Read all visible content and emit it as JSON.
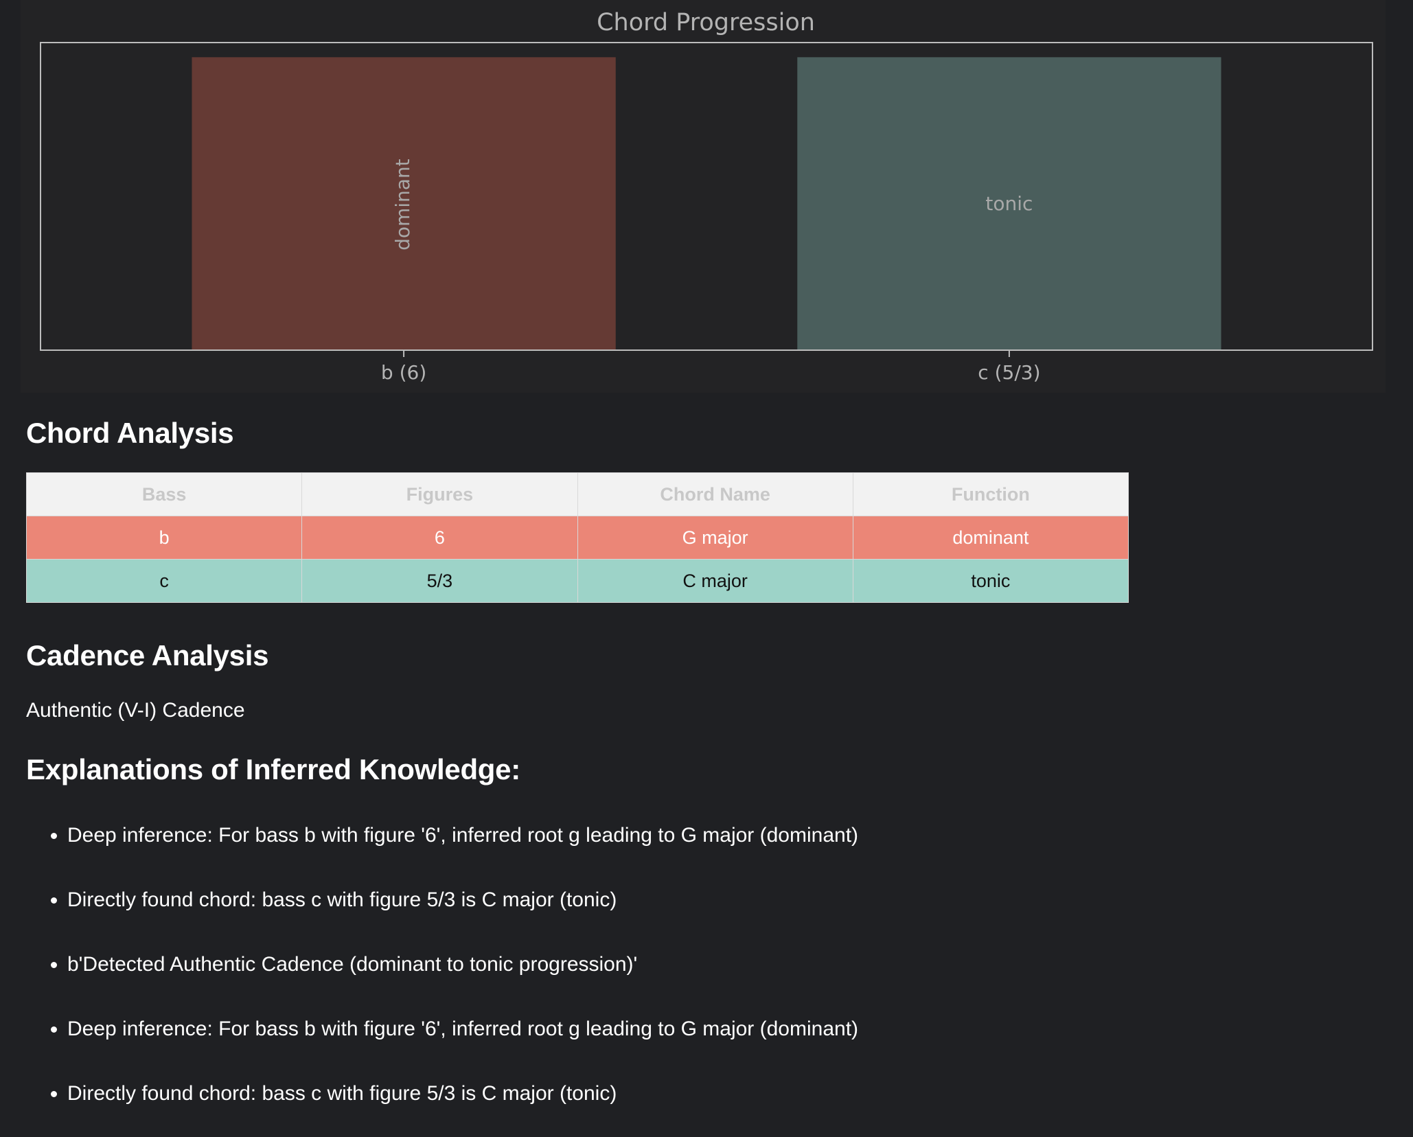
{
  "chart_data": {
    "type": "bar",
    "title": "Chord Progression",
    "categories": [
      "b (6)",
      "c (5/3)"
    ],
    "values": [
      1,
      1
    ],
    "bar_labels": [
      "dominant",
      "tonic"
    ],
    "bar_colors": [
      "#653a34",
      "#4a5e5c"
    ],
    "ylim": [
      0,
      1.05
    ],
    "xlabel": "",
    "ylabel": "",
    "grid": false
  },
  "chord_analysis": {
    "heading": "Chord Analysis",
    "columns": [
      "Bass",
      "Figures",
      "Chord Name",
      "Function"
    ],
    "rows": [
      {
        "bass": "b",
        "figures": "6",
        "chord_name": "G major",
        "function": "dominant"
      },
      {
        "bass": "c",
        "figures": "5/3",
        "chord_name": "C major",
        "function": "tonic"
      }
    ],
    "colors": {
      "dominant": "#eb8677",
      "tonic": "#9dd3c8",
      "header": "#f2f2f2"
    }
  },
  "cadence_analysis": {
    "heading": "Cadence Analysis",
    "text": "Authentic (V-I) Cadence"
  },
  "explanations": {
    "heading": "Explanations of Inferred Knowledge:",
    "items": [
      "Deep inference: For bass b with figure '6', inferred root g leading to G major (dominant)",
      "Directly found chord: bass c with figure 5/3 is C major (tonic)",
      "b'Detected Authentic Cadence (dominant to tonic progression)'",
      "Deep inference: For bass b with figure '6', inferred root g leading to G major (dominant)",
      "Directly found chord: bass c with figure 5/3 is C major (tonic)"
    ]
  }
}
